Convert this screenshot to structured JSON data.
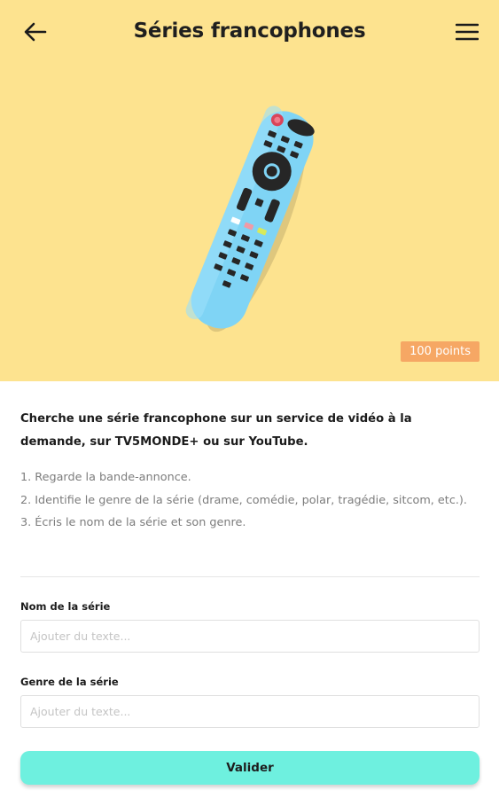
{
  "header": {
    "title": "Séries francophones",
    "back_icon": "arrow-left-icon",
    "menu_icon": "hamburger-menu-icon"
  },
  "hero": {
    "illustration": "tv-remote-illustration",
    "background_color": "#fde38f",
    "points_badge": "100 points",
    "badge_color": "#f6a764"
  },
  "task": {
    "intro": "Cherche une série francophone sur un service de vidéo à la demande, sur TV5MONDE+ ou sur YouTube.",
    "steps": [
      "1. Regarde la bande-annonce.",
      "2. Identifie le genre de la série (drame, comédie, polar, tragédie, sitcom, etc.).",
      "3. Écris le nom de la série et son genre."
    ]
  },
  "form": {
    "series_name": {
      "label": "Nom de la série",
      "placeholder": "Ajouter du texte...",
      "value": ""
    },
    "series_genre": {
      "label": "Genre de la série",
      "placeholder": "Ajouter du texte...",
      "value": ""
    },
    "submit_label": "Valider",
    "submit_color": "#6ef0df"
  }
}
